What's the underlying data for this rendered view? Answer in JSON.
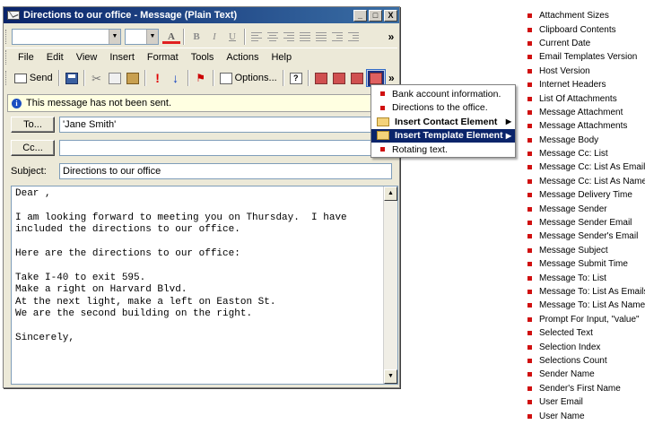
{
  "window": {
    "title": "Directions to our office - Message (Plain Text)",
    "controls": {
      "minimize": "_",
      "maximize": "□",
      "close": "X"
    }
  },
  "format_toolbar": {
    "font_color_label": "A",
    "bold_label": "B",
    "italic_label": "I",
    "underline_label": "U",
    "more_label": "»"
  },
  "menu_bar": [
    "File",
    "Edit",
    "View",
    "Insert",
    "Format",
    "Tools",
    "Actions",
    "Help"
  ],
  "standard_toolbar": {
    "send_label": "Send",
    "options_label": "Options...",
    "more_label": "»"
  },
  "info_bar": {
    "text": "This message has not been sent."
  },
  "fields": {
    "to_button": "To...",
    "to_value": "'Jane Smith'",
    "cc_button": "Cc...",
    "cc_value": "",
    "subject_label": "Subject:",
    "subject_value": "Directions to our office"
  },
  "body": {
    "text": "Dear ,\n\nI am looking forward to meeting you on Thursday.  I have\nincluded the directions to our office.\n\nHere are the directions to our office:\n\nTake I-40 to exit 595.\nMake a right on Harvard Blvd.\nAt the next light, make a left on Easton St.\nWe are the second building on the right.\n\nSincerely,"
  },
  "popup_menu": [
    {
      "label": "Bank account information.",
      "kind": "item"
    },
    {
      "label": "Directions to the office.",
      "kind": "item"
    },
    {
      "label": "Insert Contact Element",
      "kind": "submenu"
    },
    {
      "label": "Insert Template Element",
      "kind": "submenu",
      "active": true
    },
    {
      "label": "Rotating text.",
      "kind": "item"
    }
  ],
  "template_elements": [
    "Attachment Sizes",
    "Clipboard Contents",
    "Current Date",
    "Email Templates Version",
    "Host Version",
    "Internet Headers",
    "List Of Attachments",
    "Message Attachment",
    "Message Attachments",
    "Message Body",
    "Message Cc: List",
    "Message Cc: List As Emails",
    "Message Cc: List As Names",
    "Message Delivery Time",
    "Message Sender",
    "Message Sender Email",
    "Message Sender's Email",
    "Message Subject",
    "Message Submit Time",
    "Message To: List",
    "Message To: List As Emails",
    "Message To: List As Names",
    "Prompt For Input, \"value\"",
    "Selected Text",
    "Selection Index",
    "Selections Count",
    "Sender Name",
    "Sender's First Name",
    "User Email",
    "User Name"
  ],
  "colors": {
    "title_gradient_start": "#0a246a",
    "title_gradient_end": "#3a6ea5",
    "bullet_red": "#d01010",
    "menu_highlight": "#0a246a",
    "info_bar_bg": "#ffffe1"
  },
  "icons": {
    "title": "envelope-icon",
    "info": "info-icon",
    "bullet": "red-square-bullet-icon",
    "submenu_folder": "folder-icon"
  }
}
